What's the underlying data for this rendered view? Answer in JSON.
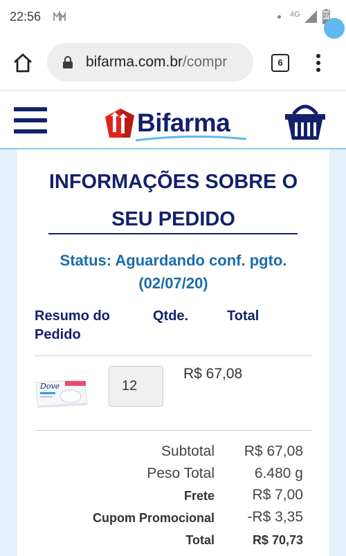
{
  "status_bar": {
    "time": "22:56",
    "network": "4G",
    "battery": "27"
  },
  "browser": {
    "url_domain": "bifarma.com.br",
    "url_path": "/compr",
    "tab_count": "6"
  },
  "site": {
    "logo_text": "Bifarma",
    "colors": {
      "brand_navy": "#13206b",
      "accent_blue": "#1b6dab",
      "badge": "#5db9ef",
      "background": "#e3f1fa"
    }
  },
  "order": {
    "title_line1": "INFORMAÇÕES SOBRE O",
    "title_line2": "SEU PEDIDO",
    "status_line1": "Status: Aguardando conf. pgto.",
    "status_line2": "(02/07/20)",
    "columns": {
      "summary_line1": "Resumo do",
      "summary_line2": "Pedido",
      "qty": "Qtde.",
      "total": "Total"
    },
    "items": [
      {
        "image": "dove-soap-product",
        "brand_on_box": "Dove",
        "qty": "12",
        "total": "R$ 67,08"
      }
    ],
    "summary": {
      "subtotal_label": "Subtotal",
      "subtotal_value": "R$ 67,08",
      "weight_label": "Peso Total",
      "weight_value": "6.480 g",
      "shipping_label": "Frete",
      "shipping_value": "R$ 7,00",
      "coupon_label": "Cupom Promocional",
      "coupon_value": "-R$ 3,35",
      "total_label": "Total",
      "total_value": "R$ 70,73"
    }
  }
}
